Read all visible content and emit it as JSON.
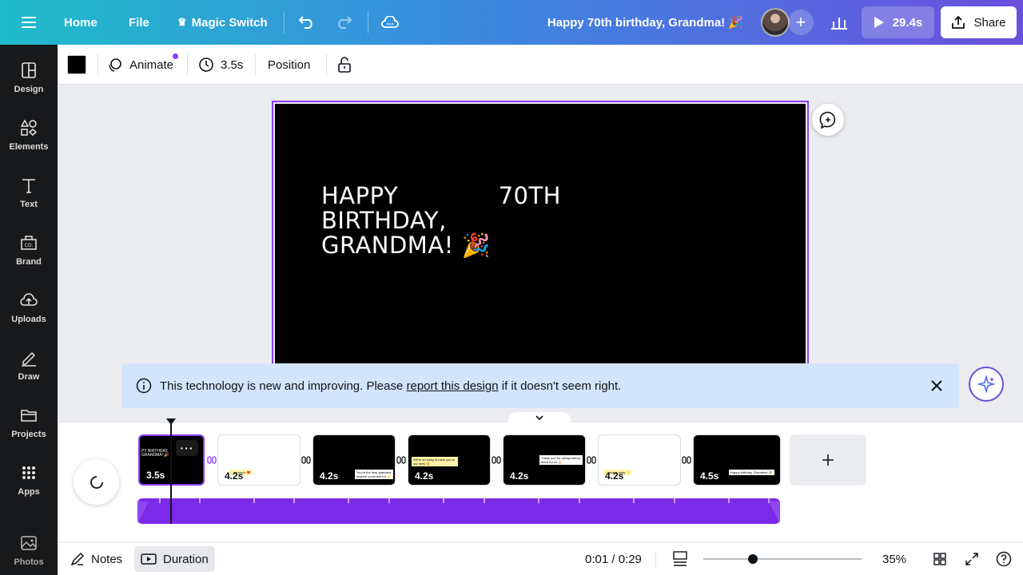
{
  "topbar": {
    "home_label": "Home",
    "file_label": "File",
    "magic_switch_label": "Magic Switch",
    "title": "Happy 70th birthday, Grandma! 🎉",
    "play_duration": "29.4s",
    "share_label": "Share"
  },
  "sidebar": {
    "items": [
      {
        "label": "Design",
        "icon": "design-icon"
      },
      {
        "label": "Elements",
        "icon": "elements-icon"
      },
      {
        "label": "Text",
        "icon": "text-icon"
      },
      {
        "label": "Brand",
        "icon": "brand-icon"
      },
      {
        "label": "Uploads",
        "icon": "upload-icon"
      },
      {
        "label": "Draw",
        "icon": "draw-icon"
      },
      {
        "label": "Projects",
        "icon": "folder-icon"
      },
      {
        "label": "Apps",
        "icon": "apps-icon"
      },
      {
        "label": "Photos",
        "icon": "photo-icon"
      }
    ]
  },
  "toolbar": {
    "color": "#000000",
    "animate_label": "Animate",
    "duration_label": "3.5s",
    "position_label": "Position"
  },
  "canvas": {
    "line1_a": "HAPPY",
    "line1_b": "70TH",
    "line2": "BIRTHDAY,",
    "line3": "GRANDMA! 🎉",
    "background": "#000000"
  },
  "notice": {
    "text_before": "This technology is new and improving. Please ",
    "link_text": "report this design",
    "text_after": " if it doesn't seem right."
  },
  "timeline": {
    "clips": [
      {
        "duration": "3.5s",
        "theme": "dark",
        "selected": true,
        "snippet": "PY BIRTHDAY, GRANDMA! 🎉"
      },
      {
        "duration": "4.2s",
        "theme": "light",
        "selected": false,
        "snippet": "...so much ❤️"
      },
      {
        "duration": "4.2s",
        "theme": "dark",
        "selected": false,
        "snippet": "You're the best grandma anyone could ask for 🌟"
      },
      {
        "duration": "4.2s",
        "theme": "dark",
        "selected": false,
        "snippet": "We're so lucky to have you in our lives 🌼"
      },
      {
        "duration": "4.2s",
        "theme": "dark",
        "selected": false,
        "snippet": "Thank you for always being there for us 🎂"
      },
      {
        "duration": "4.2s",
        "theme": "light",
        "selected": false,
        "snippet": "...have a party ✨"
      },
      {
        "duration": "4.5s",
        "theme": "dark",
        "selected": false,
        "snippet": "Happy birthday, Grandma! 🎉"
      }
    ]
  },
  "bottombar": {
    "notes_label": "Notes",
    "duration_label": "Duration",
    "time_display": "0:01 / 0:29",
    "zoom_level": "35%"
  },
  "colors": {
    "accent": "#8b3dff",
    "audio_track": "#7d2ae8",
    "notice_bg": "#d3e5fd"
  }
}
